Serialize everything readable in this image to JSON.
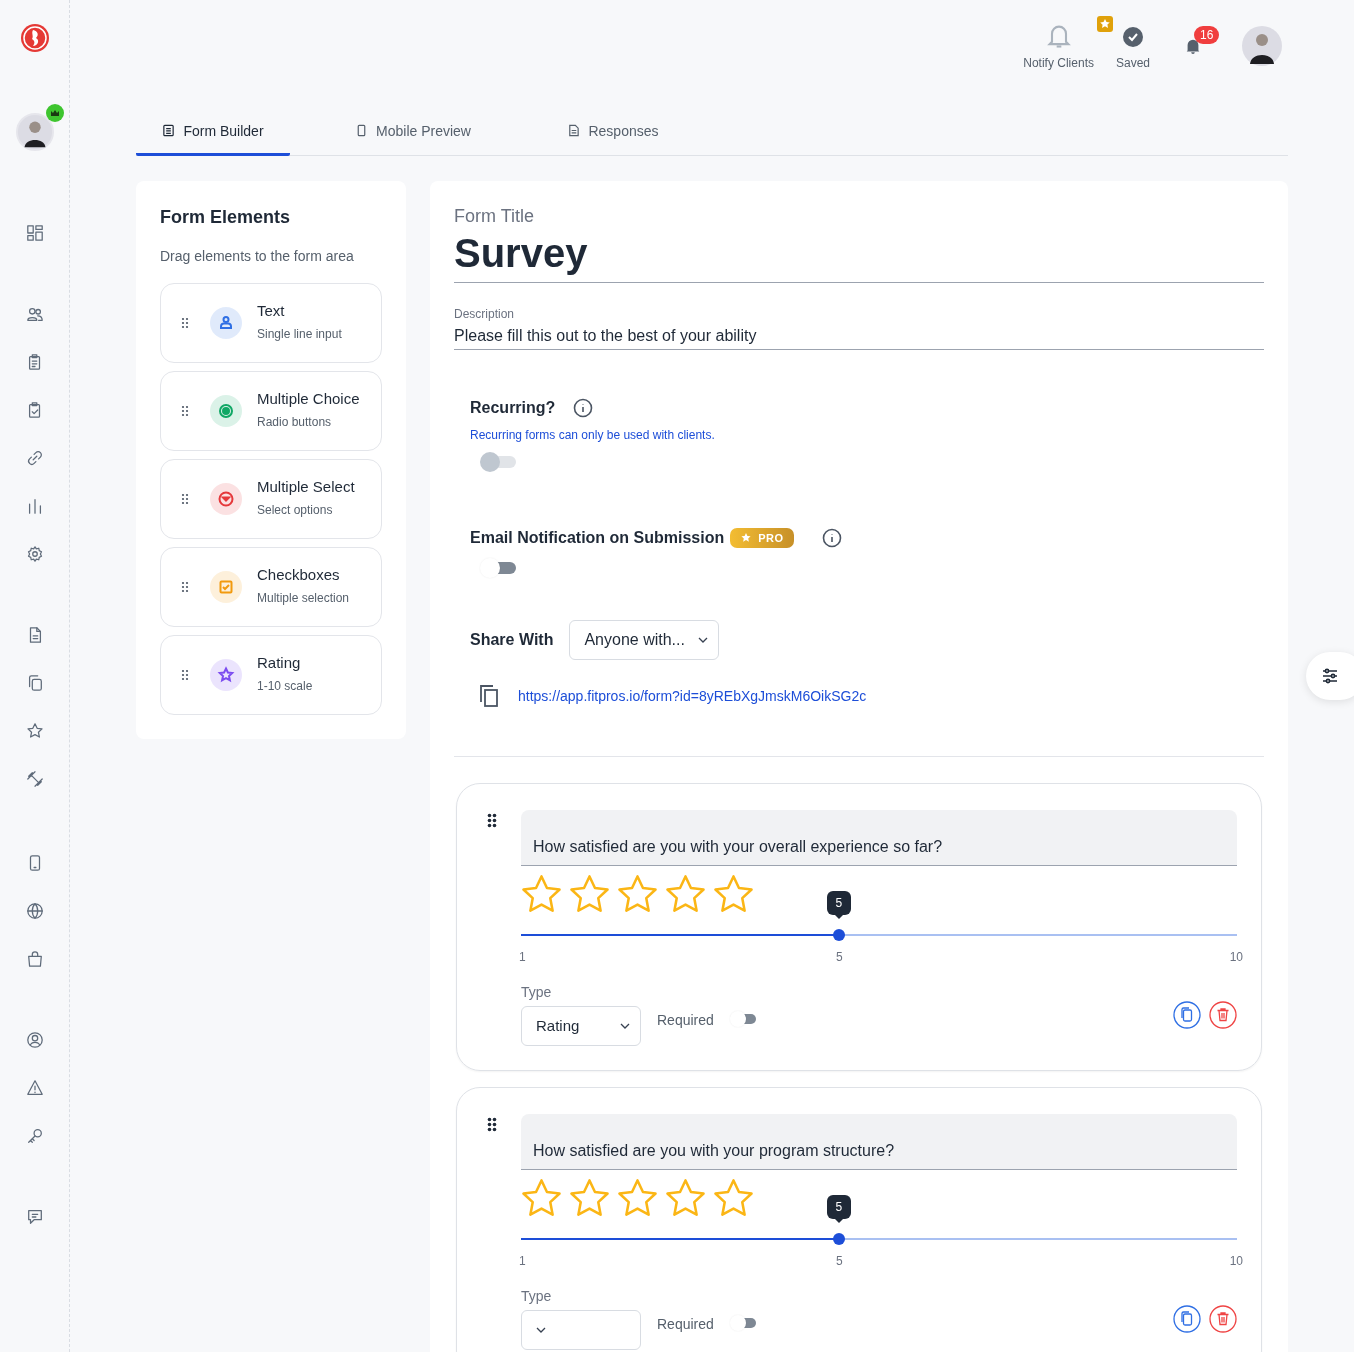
{
  "header": {
    "notify_label": "Notify Clients",
    "saved_label": "Saved",
    "notification_count": "16"
  },
  "tabs": [
    {
      "label": "Form Builder",
      "kind": "form",
      "selected": true
    },
    {
      "label": "Mobile Preview",
      "kind": "mobile",
      "selected": false
    },
    {
      "label": "Responses",
      "kind": "responses",
      "selected": false
    }
  ],
  "elements_panel": {
    "title": "Form Elements",
    "subtitle": "Drag elements to the form area",
    "items": [
      {
        "kind": "text",
        "label": "Text",
        "description": "Single line input",
        "color": "#2f6fe4"
      },
      {
        "kind": "radio",
        "label": "Multiple Choice",
        "description": "Radio buttons",
        "color": "#10a765"
      },
      {
        "kind": "select",
        "label": "Multiple Select",
        "description": "Select options",
        "color": "#e5383b"
      },
      {
        "kind": "checkbox",
        "label": "Checkboxes",
        "description": "Multiple selection",
        "color": "#f29a0f"
      },
      {
        "kind": "rating",
        "label": "Rating",
        "description": "1-10 scale",
        "color": "#7c4df0"
      }
    ]
  },
  "form": {
    "title_label": "Form Title",
    "title": "Survey",
    "description_label": "Description",
    "description": "Please fill this out to the best of your ability",
    "recurring": {
      "label": "Recurring?",
      "note": "Recurring forms can only be used with clients.",
      "on": false
    },
    "email_notification": {
      "label": "Email Notification on Submission",
      "badge": "PRO",
      "on": false
    },
    "share": {
      "label": "Share With",
      "value": "Anyone with...",
      "link": "https://app.fitpros.io/form?id=8yREbXgJmskM6OikSG2c"
    }
  },
  "questions": [
    {
      "text": "How satisfied are you with your overall experience so far?",
      "stars": 0,
      "level": 0.444,
      "value_bubble": "5",
      "ticks": [
        "1",
        "5",
        "10"
      ],
      "type_label": "Type",
      "type_value": "Rating",
      "required_label": "Required",
      "required": false
    },
    {
      "text": "How satisfied are you with your program structure?",
      "stars": 0,
      "level": 0.444,
      "value_bubble": "5",
      "ticks": [
        "1",
        "5",
        "10"
      ],
      "type_label": "Type",
      "required_label": "Required",
      "required": false
    }
  ]
}
